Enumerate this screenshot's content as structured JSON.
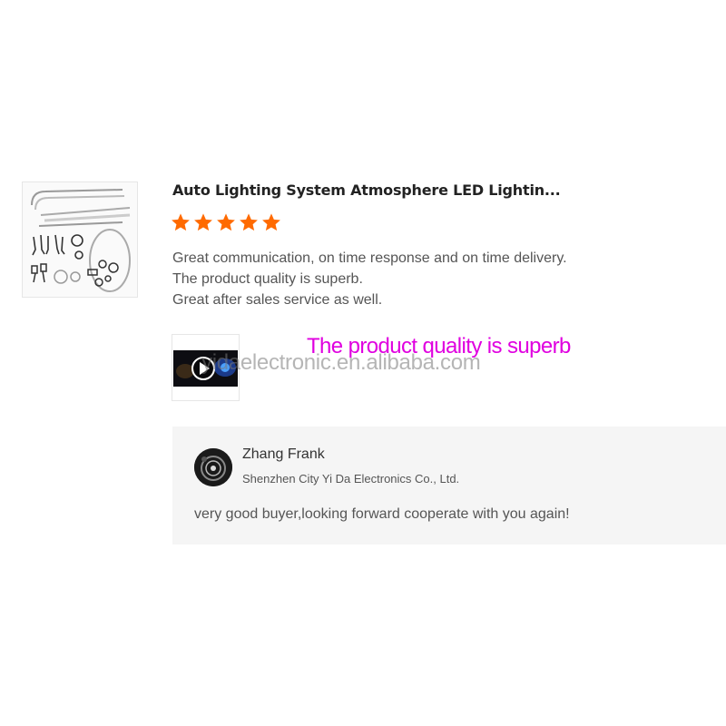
{
  "product": {
    "title": "Auto Lighting System Atmosphere LED Lightin...",
    "thumbnail_icon": "led-kit-product-image"
  },
  "review": {
    "rating": 5,
    "max_rating": 5,
    "star_color": "#ff6a00",
    "lines": [
      "Great communication, on time response and on time delivery.",
      "The product quality is superb.",
      "Great after sales service as well."
    ],
    "video_icon": "play-icon"
  },
  "overlay": {
    "caption": "The product quality is superb",
    "caption_color": "#e000e0",
    "watermark": "yidaelectronic.en.alibaba.com"
  },
  "seller_reply": {
    "name": "Zhang Frank",
    "company": "Shenzhen City Yi Da Electronics Co., Ltd.",
    "text": "very good buyer,looking forward cooperate with you again!"
  }
}
